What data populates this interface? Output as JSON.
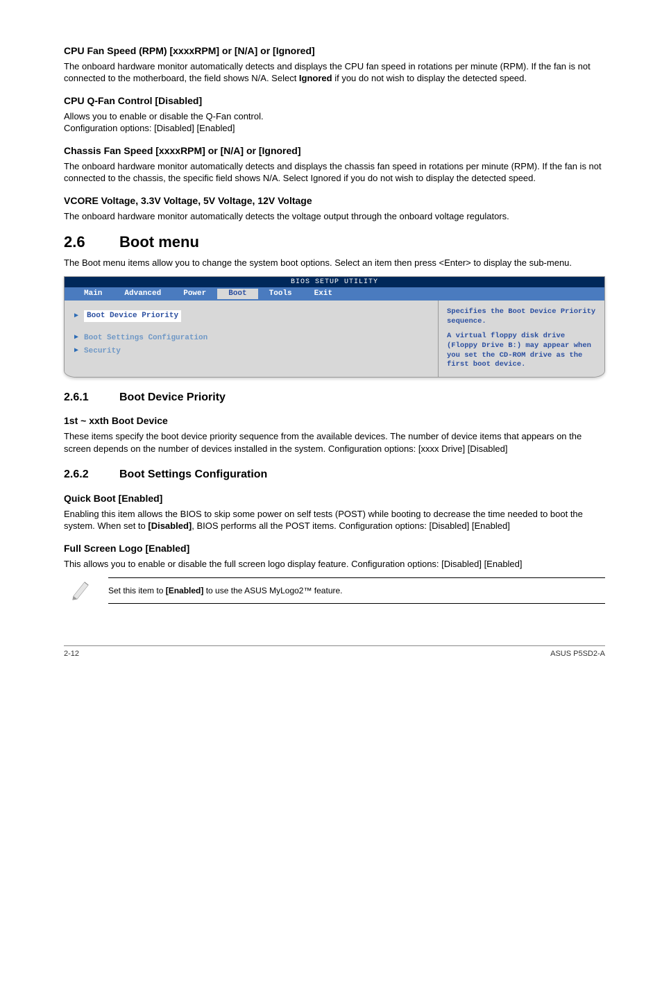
{
  "h_cpufan": "CPU Fan Speed (RPM) [xxxxRPM] or [N/A] or [Ignored]",
  "p_cpufan": "The onboard hardware monitor automatically detects and displays the CPU fan speed in rotations per minute (RPM). If the fan is not connected to the motherboard, the field shows N/A. Select ",
  "p_cpufan_b": "Ignored",
  "p_cpufan_c": " if you do not wish to display the detected speed.",
  "h_qfan": "CPU Q-Fan Control [Disabled]",
  "p_qfan1": "Allows you to enable or disable the Q-Fan control.",
  "p_qfan2": "Configuration options: [Disabled] [Enabled]",
  "h_chassis": "Chassis Fan Speed [xxxxRPM] or [N/A] or [Ignored]",
  "p_chassis": "The onboard hardware monitor automatically detects and displays the chassis fan speed in rotations per minute (RPM). If the fan is not connected to the chassis, the specific field shows N/A. Select Ignored if you do not wish to display the detected speed.",
  "h_vcore": "VCORE Voltage, 3.3V Voltage, 5V Voltage, 12V Voltage",
  "p_vcore": "The onboard hardware monitor automatically detects the voltage output through the onboard voltage regulators.",
  "sec26_num": "2.6",
  "sec26_title": "Boot menu",
  "p_boot": "The Boot menu items allow you to change the system boot options. Select an item then press <Enter> to display the sub-menu.",
  "bios": {
    "title": "BIOS SETUP UTILITY",
    "menu": [
      "Main",
      "Advanced",
      "Power",
      "Boot",
      "Tools",
      "Exit"
    ],
    "left_sel": "Boot Device Priority",
    "left_items": [
      "Boot Settings Configuration",
      "Security"
    ],
    "right1": "Specifies the Boot Device Priority sequence.",
    "right2": "A virtual floppy disk drive (Floppy Drive B:) may appear when you set the CD-ROM drive as the first boot device."
  },
  "sec261_num": "2.6.1",
  "sec261_title": "Boot Device Priority",
  "h_1st": "1st ~ xxth Boot Device",
  "p_1st": "These items specify the boot device priority sequence from the available devices. The number of device items that appears on the screen depends on the number of devices installed in the system. Configuration options: [xxxx Drive] [Disabled]",
  "sec262_num": "2.6.2",
  "sec262_title": "Boot Settings Configuration",
  "h_qb": "Quick Boot [Enabled]",
  "p_qb_a": "Enabling this item allows the BIOS to skip some power on self tests (POST) while booting to decrease the time needed to boot the system. When set to ",
  "p_qb_b": "[Disabled]",
  "p_qb_c": ", BIOS performs all the POST items. Configuration options: [Disabled] [Enabled]",
  "h_fsl": "Full Screen Logo [Enabled]",
  "p_fsl": "This allows you to enable or disable the full screen logo display feature. Configuration options: [Disabled] [Enabled]",
  "note_a": "Set this item to ",
  "note_b": "[Enabled]",
  "note_c": " to use the ASUS MyLogo2™ feature.",
  "footer_left": "2-12",
  "footer_right": "ASUS P5SD2-A"
}
